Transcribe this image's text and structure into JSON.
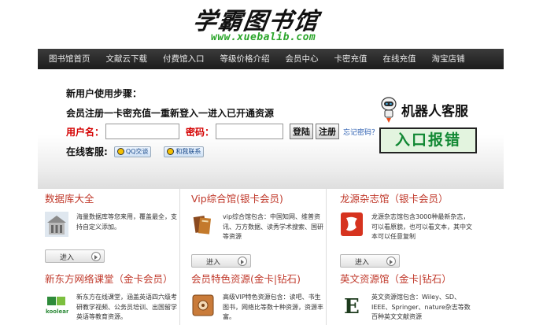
{
  "logo": {
    "title": "学霸图书馆",
    "url": "www.xuebalib.com"
  },
  "nav": [
    "图书馆首页",
    "文献云下载",
    "付费馆入口",
    "等级价格介绍",
    "会员中心",
    "卡密充值",
    "在线充值",
    "淘宝店铺"
  ],
  "panel": {
    "steps_title": "新用户使用步骤：",
    "steps_line": "会员注册一卡密充值一重新登入一进入已开通资源",
    "username_label": "用户名：",
    "password_label": "密码：",
    "login_btn": "登陆",
    "register_btn": "注册",
    "forgot": "忘记密码？",
    "service_label": "在线客服:",
    "qq1": "QQ交谈",
    "qq2": "和我联系",
    "robot_text": "机器人客服",
    "entry_btn": "入口报错"
  },
  "cards": [
    {
      "title": "数据库大全",
      "desc": "海量数据库等您来用，覆盖最全，支持自定义添加。",
      "enter": "进入"
    },
    {
      "title": "Vip综合馆(银卡会员)",
      "desc": "vip综合馆包含：中国知网、维普资讯、万方数据、读秀学术搜索、国研等资源",
      "enter": "进入"
    },
    {
      "title": "龙源杂志馆（银卡会员）",
      "desc": "龙源杂志馆包含3000种最新杂志，可以看原貌，也可以看文本，其中文本可以任意复制",
      "enter": "进入"
    },
    {
      "title": "新东方网络课堂（金卡会员）",
      "desc": "新东方在线课堂，涵盖英语四六级考研教学视频、公务员培训、出国留学英语等教育资源。",
      "logo": "koolearn"
    },
    {
      "title": "会员特色资源(金卡|钻石)",
      "desc": "高级VIP特色资源包含：读吧、书生图书，网络比等数十种资源，资源丰富。"
    },
    {
      "title": "英文资源馆（金卡|钻石）",
      "desc": "英文资源馆包含：Wiley、SD、IEEE、Springer、nature杂志等数百种英文文献资源"
    }
  ],
  "colors": {
    "nav_bg": "#1c1c1c",
    "card_title": "#c0392b",
    "label_red": "#d40000",
    "logo_url": "#2aa52a",
    "entry_green": "#118833"
  }
}
